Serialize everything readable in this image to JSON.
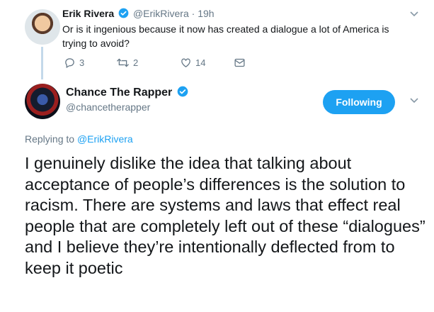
{
  "colors": {
    "accent": "#1da1f2",
    "muted": "#657786",
    "text": "#14171a",
    "thread": "#c4d9ea"
  },
  "reply_tweet": {
    "author_name": "Erik Rivera",
    "handle": "@ErikRivera",
    "separator": "·",
    "time": "19h",
    "text": "Or is it ingenious because it now has created a dialogue a lot of America is trying to avoid?",
    "reply_count": "3",
    "retweet_count": "2",
    "like_count": "14",
    "icons": [
      "reply-icon",
      "retweet-icon",
      "like-icon",
      "message-icon",
      "chevron-down-icon",
      "verified-icon"
    ]
  },
  "main_tweet": {
    "author_name": "Chance The Rapper",
    "handle": "@chancetherapper",
    "follow_label": "Following",
    "replying_prefix": "Replying to",
    "replying_to": "@ErikRivera",
    "text": "I genuinely dislike the idea that talking about acceptance of people’s differences is the solution to racism. There are systems and laws that effect real people that are completely left out of these “dialogues” and I believe they’re intentionally deflected from to keep it poetic"
  }
}
